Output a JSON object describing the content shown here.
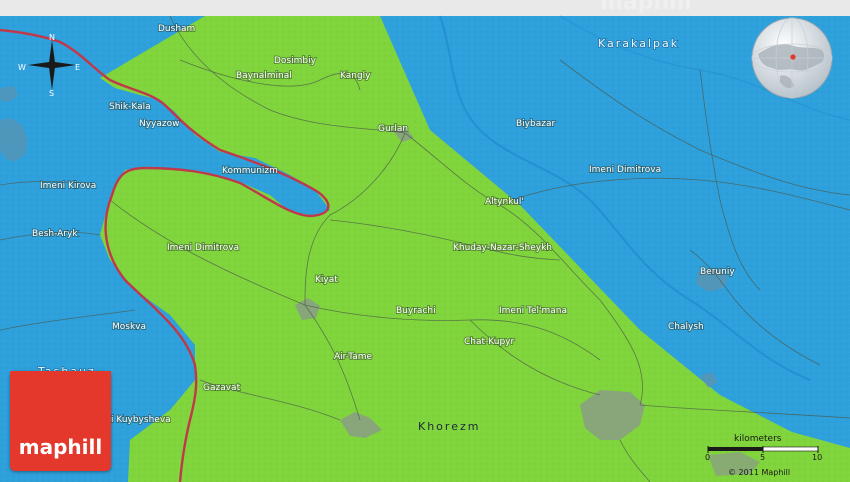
{
  "map": {
    "colors": {
      "water": "#2ea0dc",
      "land": "#80d43c",
      "road": "#4a5a4a",
      "border": "#c0394a",
      "urban": "#8a9a8a"
    },
    "watermark": "maphill",
    "logo_text": "maphill",
    "compass": {
      "n": "N",
      "e": "E",
      "s": "S",
      "w": "W"
    },
    "scale": {
      "title": "kilometers",
      "ticks": [
        "0",
        "5",
        "10"
      ]
    },
    "copyright": "© 2011 Maphill",
    "regions": {
      "karakalpak": "Karakalpak",
      "khorezm": "Khorezm",
      "tashauz": "Tashauz"
    },
    "places": {
      "dusham": "Dusham",
      "dosimbiy": "Dosimbiy",
      "baynalminal": "Baynalminal",
      "kangly": "Kangly",
      "shik_kala": "Shik-Kala",
      "nyyazow": "Nyyazow",
      "gurlan": "Gurlan",
      "biybazar": "Biybazar",
      "imeni_dimitrova_e": "Imeni Dimitrova",
      "kommunizm": "Kommunizm",
      "imeni_kirova": "Imeni Kirova",
      "altynkul": "Altynkul'",
      "besh_aryk": "Besh-Aryk",
      "khuday": "Khuday-Nazar-Sheykh",
      "imeni_dimitrova_w": "Imeni Dimitrova",
      "kiyat": "Kiyat",
      "beruniy": "Beruniy",
      "buyrachi": "Buyrachi",
      "imeni_telmana": "Imeni Tel'mana",
      "moskva": "Moskva",
      "chalysh": "Chalysh",
      "chat_kupyr": "Chat-Kupyr",
      "air_tame": "Air-Tame",
      "gazavat": "Gazavat",
      "kuybysheva": "i Kuybysheva"
    }
  }
}
